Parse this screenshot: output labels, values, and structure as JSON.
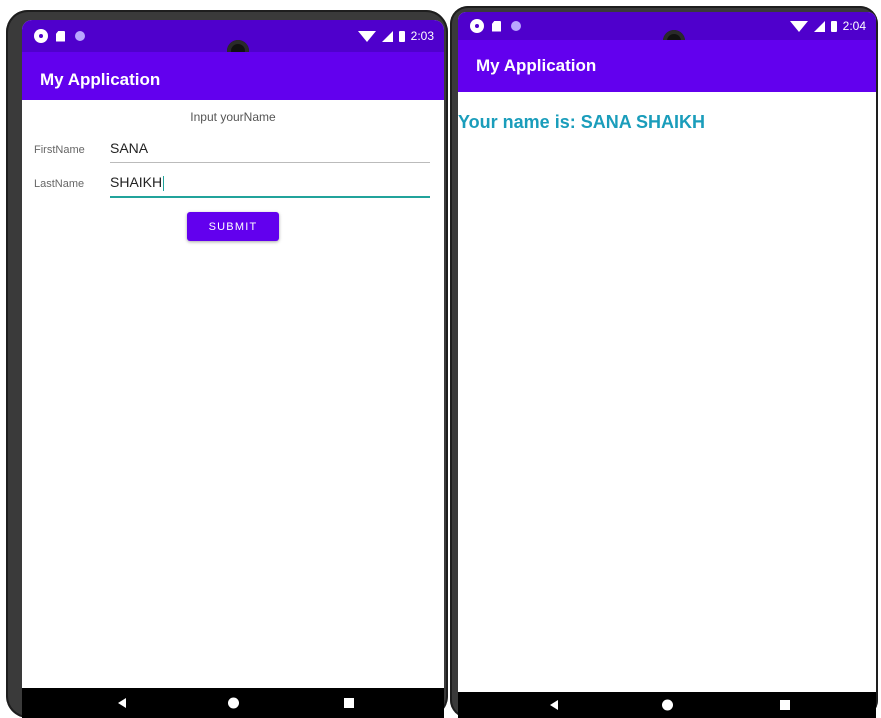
{
  "screens": [
    {
      "status_time": "2:03",
      "app_title": "My Application",
      "input_title": "Input yourName",
      "first_name_label": "FirstName",
      "first_name_value": "SANA",
      "last_name_label": "LastName",
      "last_name_value": "SHAIKH",
      "submit_label": "SUBMIT"
    },
    {
      "status_time": "2:04",
      "app_title": "My Application",
      "result_text": "Your name is: SANA SHAIKH"
    }
  ],
  "status_icons": [
    "gear-icon",
    "sdcard-icon",
    "dot-icon",
    "wifi-icon",
    "signal-icon",
    "battery-icon"
  ],
  "nav_icons": [
    "back-icon",
    "home-icon",
    "recents-icon"
  ],
  "colors": {
    "status_bar": "#4f00cc",
    "app_bar": "#6200ee",
    "button": "#6200ee",
    "result_text": "#1a9dbb",
    "field_accent": "#21a39b"
  }
}
